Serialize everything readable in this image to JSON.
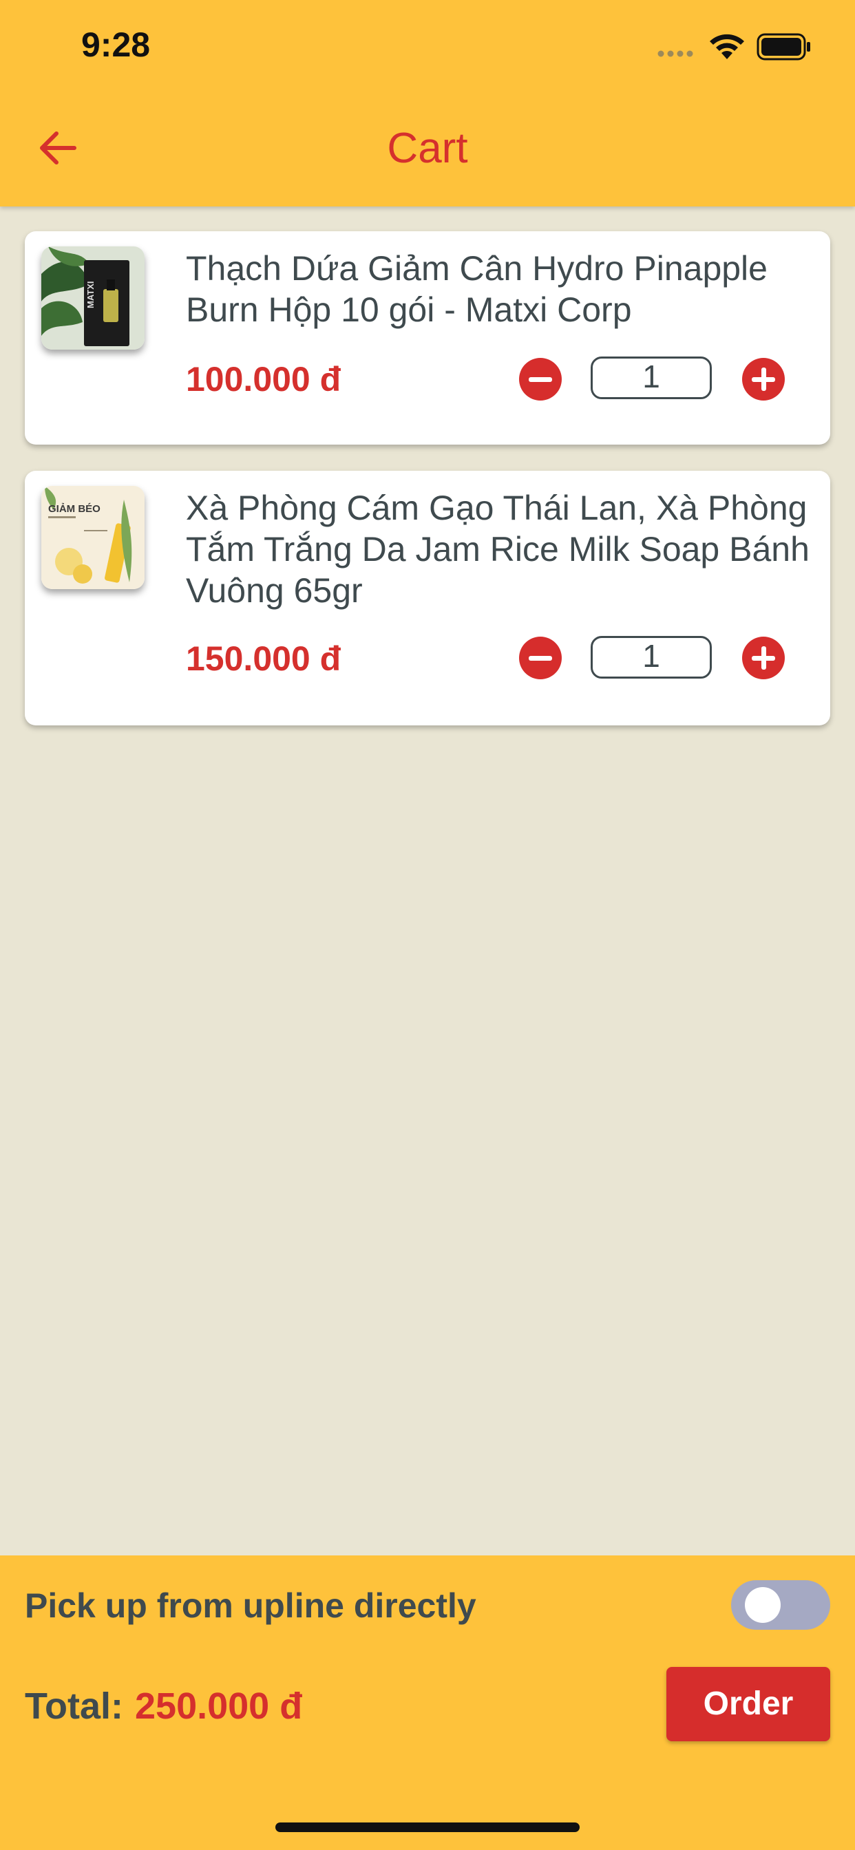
{
  "status_bar": {
    "time": "9:28",
    "icons": [
      "signal-icon",
      "wifi-icon",
      "battery-icon"
    ]
  },
  "header": {
    "title": "Cart",
    "back_icon": "arrow-left-icon"
  },
  "cart": {
    "items": [
      {
        "name": "Thạch Dứa Giảm Cân Hydro Pinapple Burn Hộp 10 gói - Matxi Corp",
        "price": "100.000 đ",
        "quantity": "1",
        "thumb_text": "MATXI"
      },
      {
        "name": "Xà Phòng Cám Gạo Thái Lan, Xà Phòng Tắm Trắng Da Jam Rice Milk Soap Bánh Vuông 65gr",
        "price": "150.000 đ",
        "quantity": "1",
        "thumb_text": "GIẢM BÉO"
      }
    ]
  },
  "footer": {
    "pickup_label": "Pick up from upline directly",
    "pickup_enabled": false,
    "total_label": "Total:",
    "total_value": "250.000 đ",
    "order_label": "Order"
  },
  "colors": {
    "accent": "#FEC23B",
    "brand_red": "#D5302D",
    "background": "#E9E5D3",
    "text": "#3F4A4E",
    "toggle_off": "#A5A9C3"
  }
}
